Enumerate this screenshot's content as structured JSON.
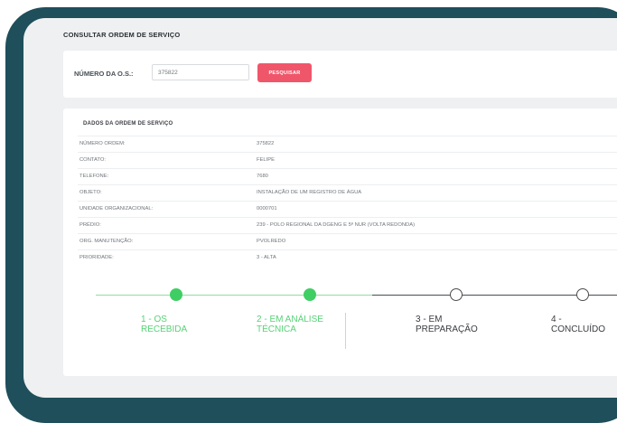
{
  "page": {
    "title": "CONSULTAR ORDEM DE SERVIÇO"
  },
  "search": {
    "label": "NÚMERO DA O.S.:",
    "value": "375822",
    "button_label": "PESQUISAR"
  },
  "details": {
    "section_title": "DADOS DA ORDEM DE SERVIÇO",
    "rows": [
      {
        "key": "NÚMERO ORDEM:",
        "value": "375822"
      },
      {
        "key": "CONTATO:",
        "value": "FELIPE"
      },
      {
        "key": "TELEFONE:",
        "value": "7680"
      },
      {
        "key": "OBJETO:",
        "value": "INSTALAÇÃO DE UM REGISTRO DE ÁGUA"
      },
      {
        "key": "UNIDADE ORGANIZACIONAL:",
        "value": "0000701"
      },
      {
        "key": "PRÉDIO:",
        "value": "239 - POLO REGIONAL DA DGENG E 5ª NUR (VOLTA REDONDA)"
      },
      {
        "key": "ORG. MANUTENÇÃO:",
        "value": "PVOLREDO"
      },
      {
        "key": "PRIORIDADE:",
        "value": "3 - ALTA"
      }
    ]
  },
  "timeline": {
    "steps": [
      {
        "label": "1 - OS\nRECEBIDA",
        "status": "done"
      },
      {
        "label": "2 - EM ANÁLISE\nTÉCNICA",
        "status": "done"
      },
      {
        "label": "3 - EM\nPREPARAÇÃO",
        "status": "todo"
      },
      {
        "label": "4 -\nCONCLUÍDO",
        "status": "todo"
      }
    ],
    "colors": {
      "done": "#3fce63",
      "todo": "#4a4d50",
      "line_done": "#8fe0a3"
    }
  },
  "colors": {
    "frame": "#1e4f5b",
    "accent_button": "#f0566a",
    "background": "#eef0f1"
  }
}
